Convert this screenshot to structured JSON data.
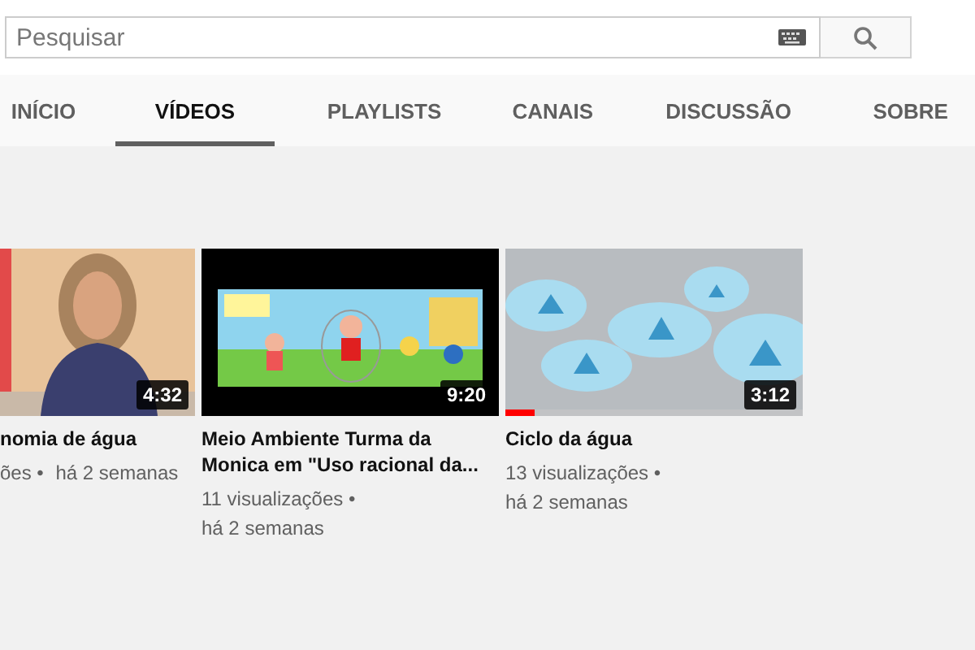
{
  "search": {
    "placeholder": "Pesquisar"
  },
  "tabs": [
    {
      "label": "INÍCIO",
      "selected": false
    },
    {
      "label": "VÍDEOS",
      "selected": true
    },
    {
      "label": "PLAYLISTS",
      "selected": false
    },
    {
      "label": "CANAIS",
      "selected": false
    },
    {
      "label": "DISCUSSÃO",
      "selected": false
    },
    {
      "label": "SOBRE",
      "selected": false
    }
  ],
  "videos": [
    {
      "duration": "4:32",
      "title": "nomia de água",
      "views": "ões •",
      "age": "há 2 semanas"
    },
    {
      "duration": "9:20",
      "title": "Meio Ambiente Turma da Monica em \"Uso racional da...",
      "views": "11 visualizações •",
      "age": "há 2 semanas"
    },
    {
      "duration": "3:12",
      "title": "Ciclo da água",
      "views": "13 visualizações •",
      "age": "há 2 semanas",
      "level": 0.1
    }
  ]
}
